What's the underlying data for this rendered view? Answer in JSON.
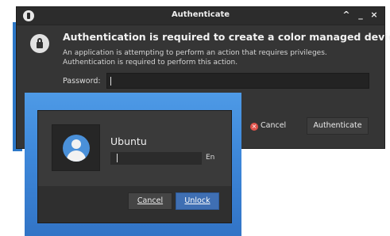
{
  "auth_window": {
    "title": "Authenticate",
    "titlebar_buttons": {
      "up": "^",
      "minimize": "_",
      "close": "×"
    },
    "heading": "Authentication is required to create a color managed device",
    "message": "An application is attempting to perform an action that requires privileges. Authentication is required to perform this action.",
    "password_label": "Password:",
    "password_value": "",
    "cancel_label": "Cancel",
    "authenticate_label": "Authenticate",
    "icons": {
      "window": "lock-icon",
      "dialog": "lock-icon",
      "cancel": "cancel-icon"
    }
  },
  "unlock_dialog": {
    "user_name": "Ubuntu",
    "password_value": "",
    "language_indicator": "En",
    "cancel_label": "Cancel",
    "unlock_label": "Unlock",
    "icons": {
      "avatar": "user-avatar-icon"
    }
  },
  "colors": {
    "dialog_bg": "#353535",
    "desktop_blue": "#3d87d9",
    "accent_button": "#3f6fb3",
    "cancel_icon": "#e0534b"
  }
}
